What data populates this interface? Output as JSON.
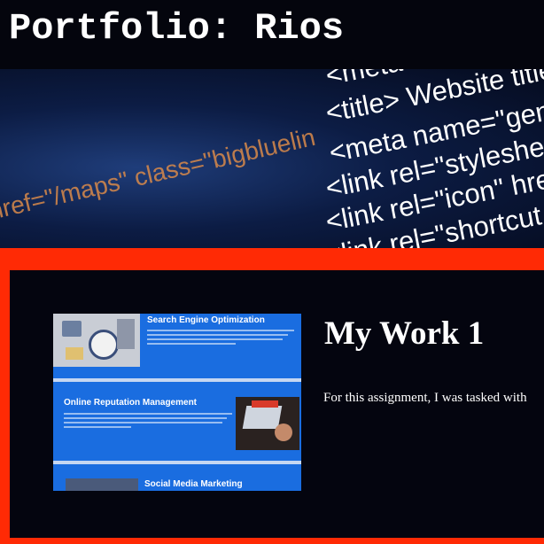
{
  "header": {
    "title": "Portfolio: Rios"
  },
  "hero": {
    "code_lines": [
      "<meta title",
      "<title> Website title",
      "<meta name=\"gener",
      "<link rel=\"stylesheet",
      "<link rel=\"icon\" href",
      "<link rel=\"shortcut ic",
      "href=\"/maps\" class=\"bigbluelin"
    ]
  },
  "work": {
    "title": "My Work 1",
    "description": "For this assignment, I was tasked with",
    "thumbnail": {
      "sections": [
        "Search Engine Optimization",
        "Online Reputation Management",
        "Social Media Marketing"
      ]
    }
  },
  "colors": {
    "frame": "#ff2a05",
    "panel": "#04050f",
    "thumbnail": "#1a6de0"
  }
}
